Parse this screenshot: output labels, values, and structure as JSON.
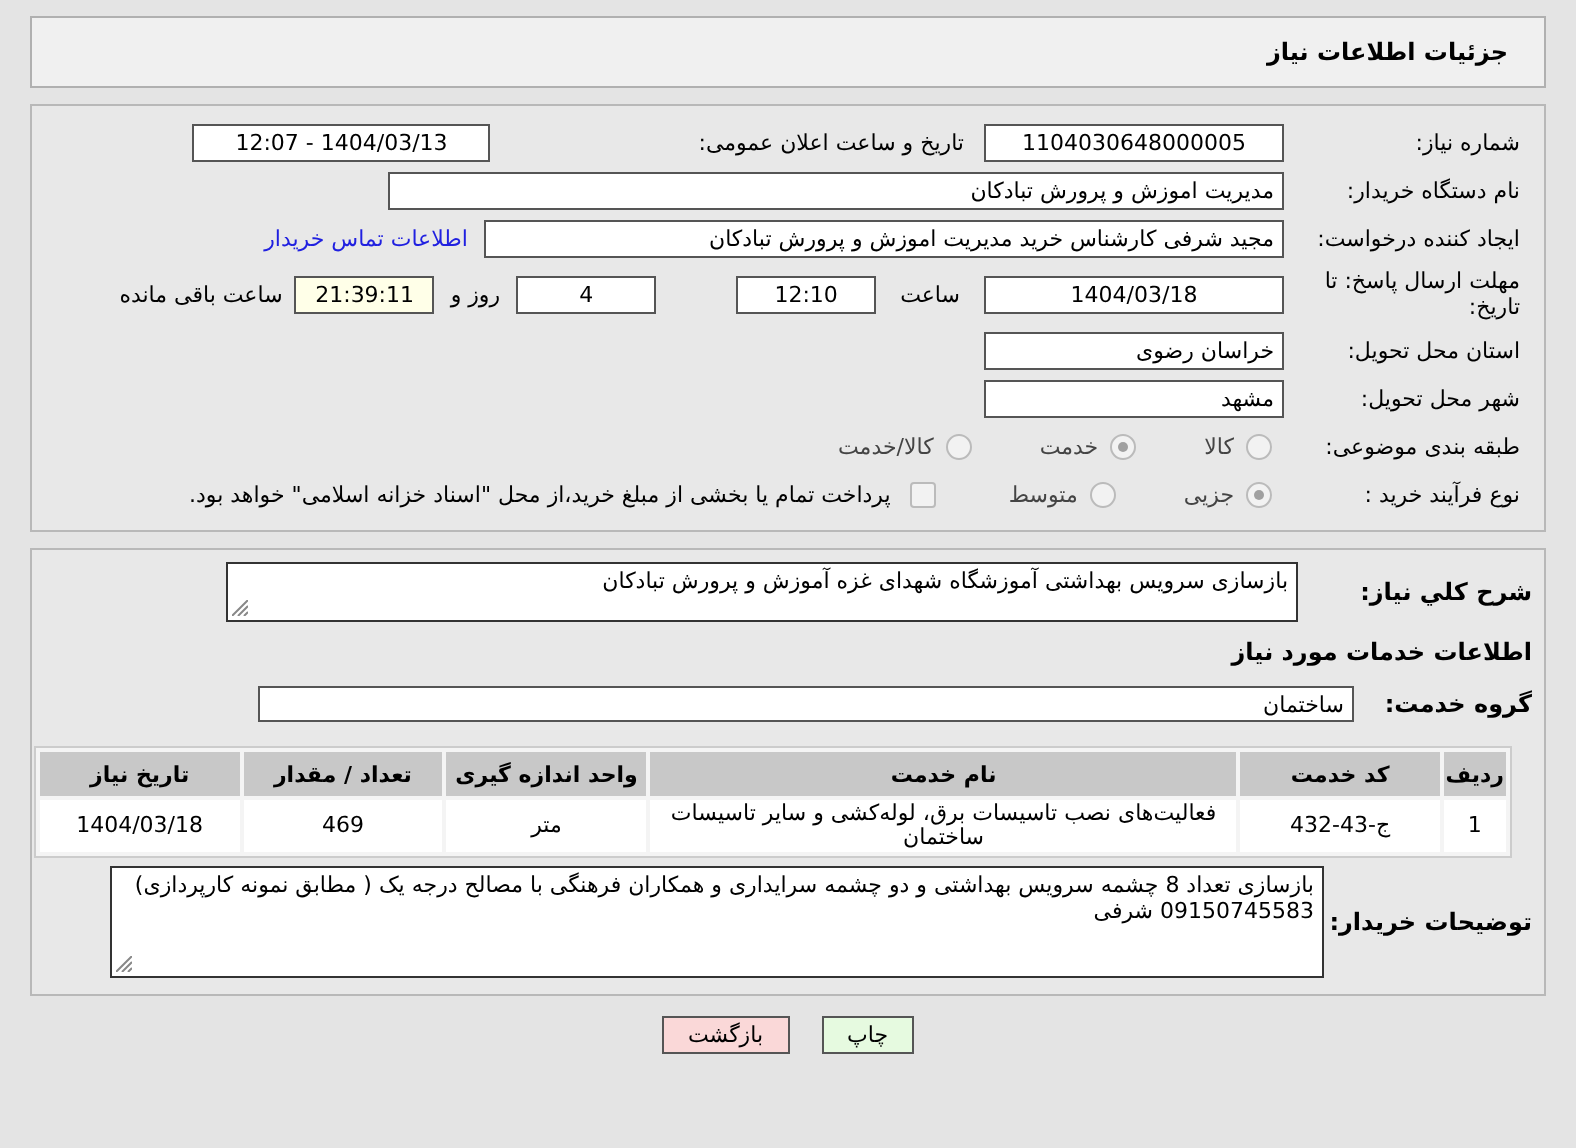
{
  "header": {
    "title": "جزئیات اطلاعات نیاز"
  },
  "details": {
    "need_number": {
      "label": "شماره نیاز:",
      "value": "1104030648000005"
    },
    "announce": {
      "label": "تاریخ و ساعت اعلان عمومی:",
      "value": "1404/03/13 - 12:07"
    },
    "buyer": {
      "label": "نام دستگاه خریدار:",
      "value": "مدیریت اموزش و پرورش تبادکان"
    },
    "creator": {
      "label": "ایجاد کننده درخواست:",
      "value": "مجید شرفی کارشناس خرید مدیریت اموزش و پرورش تبادکان",
      "link": "اطلاعات تماس خریدار"
    },
    "deadline": {
      "label": "مهلت ارسال پاسخ: تا تاریخ:",
      "date": "1404/03/18",
      "time_label": "ساعت",
      "time": "12:10",
      "days": "4",
      "days_label": "روز و",
      "remaining": "21:39:11",
      "remaining_label": "ساعت باقی مانده"
    },
    "province": {
      "label": "استان محل تحویل:",
      "value": "خراسان رضوی"
    },
    "city": {
      "label": "شهر محل تحویل:",
      "value": "مشهد"
    },
    "category": {
      "label": "طبقه بندی موضوعی:",
      "options": [
        {
          "label": "كالا",
          "selected": false
        },
        {
          "label": "خدمت",
          "selected": true
        },
        {
          "label": "كالا/خدمت",
          "selected": false
        }
      ]
    },
    "process": {
      "label": "نوع فرآیند خرید :",
      "options": [
        {
          "label": "جزیی",
          "selected": true
        },
        {
          "label": "متوسط",
          "selected": false
        }
      ],
      "payment": {
        "checked": false,
        "label": "پرداخت تمام یا بخشی از مبلغ خرید،از محل \"اسناد خزانه اسلامی\" خواهد بود."
      }
    }
  },
  "summary": {
    "label": "شرح كلي نياز:",
    "value": "بازسازی سرویس بهداشتی آموزشگاه شهدای غزه آموزش و پرورش تبادکان"
  },
  "services": {
    "heading": "اطلاعات خدمات مورد نیاز",
    "group_label": "گروه خدمت:",
    "group": "ساختمان",
    "table": {
      "columns": [
        "ردیف",
        "کد خدمت",
        "نام خدمت",
        "واحد اندازه گیری",
        "تعداد / مقدار",
        "تاریخ نیاز"
      ],
      "rows": [
        [
          "1",
          "ج-43-432",
          "فعالیت‌های نصب تاسیسات برق، لوله‌کشی و سایر تاسیسات ساختمان",
          "متر",
          "469",
          "1404/03/18"
        ]
      ]
    }
  },
  "notes": {
    "label": "توضیحات خریدار:",
    "lines": [
      "بازسازی تعداد 8 چشمه سرویس بهداشتی و دو چشمه سرایداری و همکاران فرهنگی با مصالح درجه یک ( مطابق نمونه کارپردازی)",
      "09150745583 شرفی"
    ]
  },
  "buttons": [
    {
      "kind": "print",
      "label": "چاپ"
    },
    {
      "kind": "back",
      "label": "بازگشت"
    }
  ]
}
